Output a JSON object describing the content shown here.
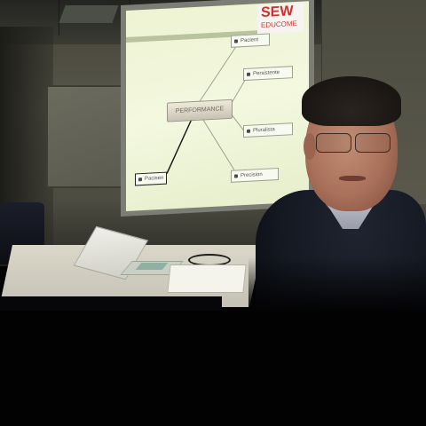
{
  "projection": {
    "logo": {
      "main": "SEW",
      "sub": "EDUCOME"
    },
    "center_label": "PERFORMANCE",
    "branch_labels": [
      "Pacient",
      "Persistente",
      "Pluralista",
      "Pacisen",
      "Precision"
    ]
  },
  "colors": {
    "slide_bg": "#eef3d3",
    "logo_red": "#d1302a",
    "wall": "#57564a",
    "jacket": "#141821"
  }
}
